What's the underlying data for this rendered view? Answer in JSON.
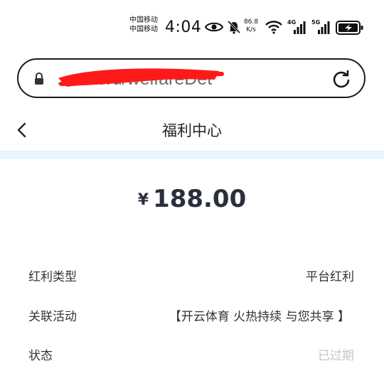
{
  "status_bar": {
    "carrier_1": "中国移动",
    "carrier_2": "中国移动",
    "time": "4:04",
    "speed_value": "86.8",
    "speed_unit": "K/s",
    "net_1": "4G",
    "net_2": "5G",
    "icons": [
      "eye-icon",
      "bell-off-icon",
      "wifi-icon",
      "signal-icon",
      "signal-icon",
      "battery-charging-icon"
    ]
  },
  "browser": {
    "url_visible": "...record/welfareDet",
    "icons": [
      "lock-icon",
      "reload-icon"
    ]
  },
  "header": {
    "title": "福利中心",
    "back_icon": "chevron-left-icon"
  },
  "amount": {
    "currency": "¥",
    "value": "188.00"
  },
  "details": [
    {
      "label": "红利类型",
      "value": "平台红利"
    },
    {
      "label": "关联活动",
      "value": "【开云体育 火热持续 与您共享 】"
    },
    {
      "label": "状态",
      "value": "已过期"
    }
  ],
  "colors": {
    "band": "#e9f4fd",
    "amount": "#2b2e3d",
    "muted": "#c2c6cf",
    "redaction": "#ff1a1a"
  }
}
